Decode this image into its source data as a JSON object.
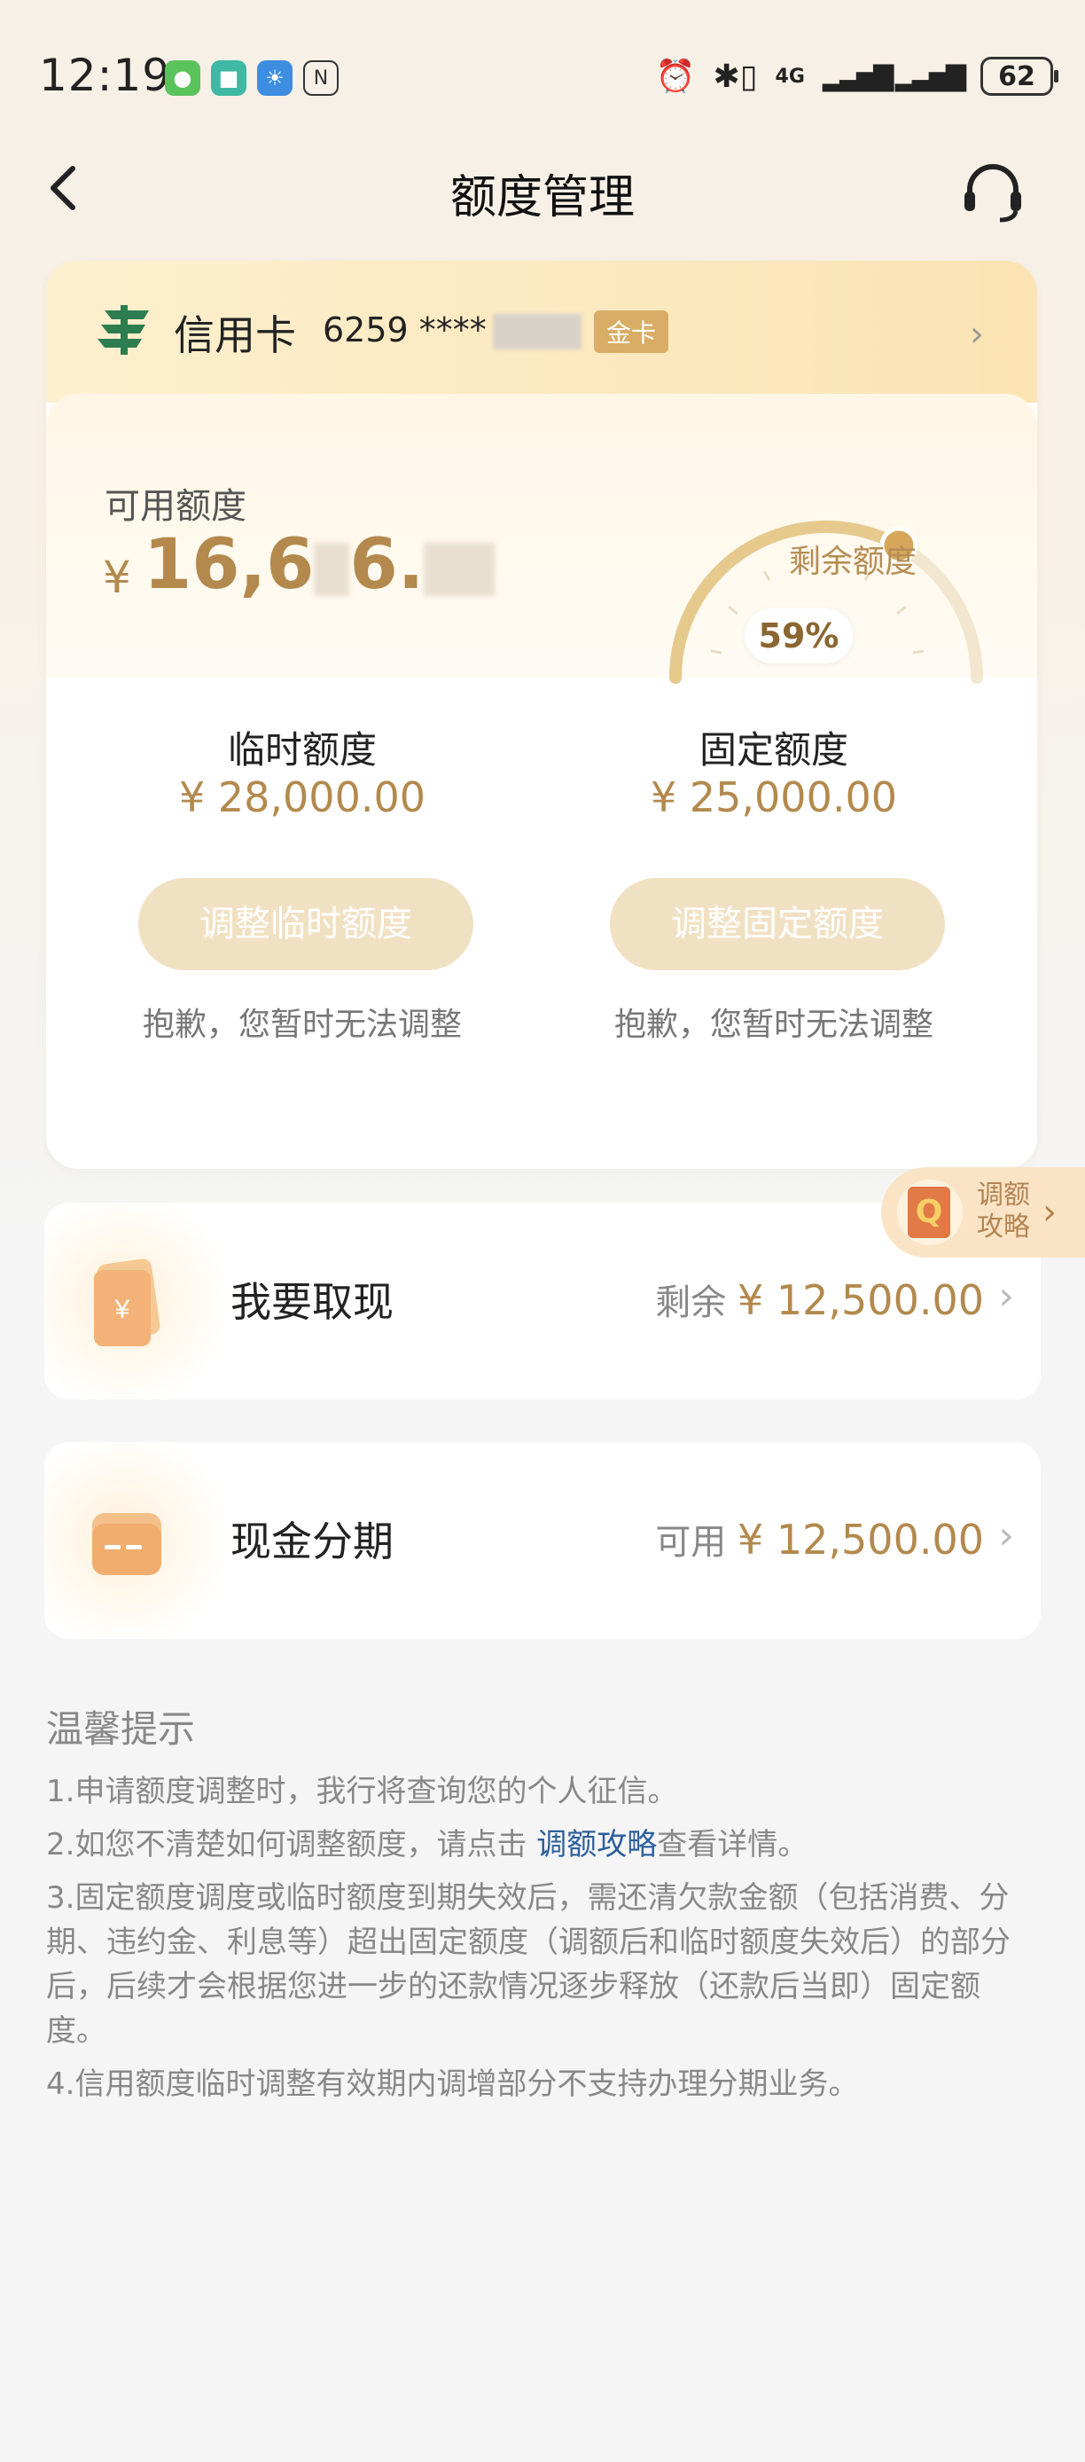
{
  "status_bar": {
    "time": "12:19",
    "battery": "62",
    "network": "4G"
  },
  "nav": {
    "title": "额度管理"
  },
  "card": {
    "name": "信用卡",
    "number_prefix": "6259 ****",
    "badge": "金卡"
  },
  "balance": {
    "label": "可用额度",
    "currency": "¥",
    "amount_visible": "16,6",
    "amount_mid": "6.",
    "gauge_label": "剩余额度",
    "remaining_percent": "59%",
    "remaining_fraction": 0.59
  },
  "limits": {
    "temporary": {
      "title": "临时额度",
      "value": "¥ 28,000.00",
      "button": "调整临时额度",
      "note": "抱歉，您暂时无法调整"
    },
    "fixed": {
      "title": "固定额度",
      "value": "¥ 25,000.00",
      "button": "调整固定额度",
      "note": "抱歉，您暂时无法调整"
    }
  },
  "tip_float": {
    "line1": "调额",
    "line2": "攻略"
  },
  "actions": {
    "withdraw": {
      "label": "我要取现",
      "prefix": "剩余",
      "amount": "¥ 12,500.00"
    },
    "installment": {
      "label": "现金分期",
      "prefix": "可用",
      "amount": "¥ 12,500.00"
    }
  },
  "tips": {
    "title": "温馨提示",
    "item1": "1.申请额度调整时，我行将查询您的个人征信。",
    "item2_before": "2.如您不清楚如何调整额度，请点击 ",
    "item2_link": "调额攻略",
    "item2_after": "查看详情。",
    "item3": "3.固定额度调度或临时额度到期失效后，需还清欠款金额（包括消费、分期、违约金、利息等）超出固定额度（调额后和临时额度失效后）的部分后，后续才会根据您进一步的还款情况逐步释放（还款后当即）固定额度。",
    "item4": "4.信用额度临时调整有效期内调增部分不支持办理分期业务。"
  }
}
